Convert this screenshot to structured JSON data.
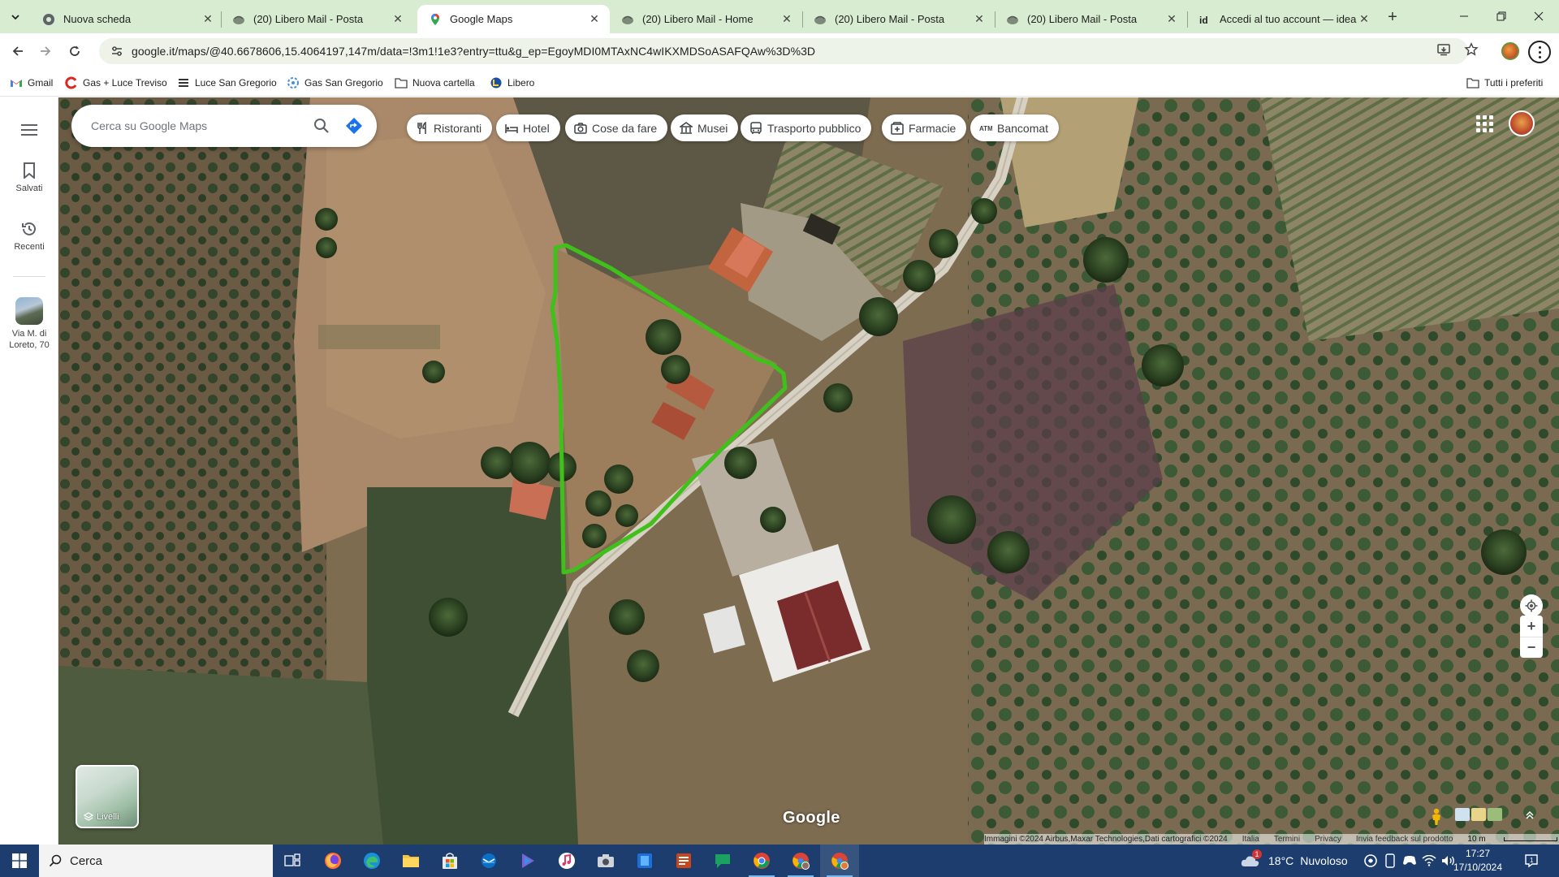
{
  "browser": {
    "tabs": [
      {
        "title": "Nuova scheda",
        "icon": "chrome-icon",
        "active": false
      },
      {
        "title": "(20) Libero Mail - Posta",
        "icon": "libero-icon",
        "active": false
      },
      {
        "title": "Google Maps",
        "icon": "maps-pin-icon",
        "active": true
      },
      {
        "title": "(20) Libero Mail - Home",
        "icon": "libero-icon",
        "active": false
      },
      {
        "title": "(20) Libero Mail - Posta",
        "icon": "libero-icon",
        "active": false
      },
      {
        "title": "(20) Libero Mail - Posta",
        "icon": "libero-icon",
        "active": false
      },
      {
        "title": "Accedi al tuo account — idealis",
        "icon": "idealista-icon",
        "active": false
      }
    ],
    "url": "google.it/maps/@40.6678606,15.4064197,147m/data=!3m1!1e3?entry=ttu&g_ep=EgoyMDI0MTAxNC4wIKXMDSoASAFQAw%3D%3D",
    "bookmarks": [
      {
        "label": "Gmail",
        "icon": "gmail-icon"
      },
      {
        "label": "Gas + Luce Treviso",
        "icon": "gas-icon"
      },
      {
        "label": "Luce San Gregorio",
        "icon": "luce-icon"
      },
      {
        "label": "Gas San Gregorio",
        "icon": "gas-blue-icon"
      },
      {
        "label": "Nuova cartella",
        "icon": "folder-icon"
      },
      {
        "label": "Libero",
        "icon": "libero-icon"
      }
    ],
    "all_bookmarks_label": "Tutti i preferiti"
  },
  "maps": {
    "sidebar": {
      "saved_label": "Salvati",
      "recent_label": "Recenti",
      "recent_place_label": "Via M. di Loreto, 70"
    },
    "search": {
      "placeholder": "Cerca su Google Maps"
    },
    "chips": [
      {
        "label": "Ristoranti",
        "icon": "fork-knife-icon"
      },
      {
        "label": "Hotel",
        "icon": "bed-icon"
      },
      {
        "label": "Cose da fare",
        "icon": "camera-icon"
      },
      {
        "label": "Musei",
        "icon": "museum-icon"
      },
      {
        "label": "Trasporto pubblico",
        "icon": "bus-icon"
      },
      {
        "label": "Farmacie",
        "icon": "pharmacy-icon"
      },
      {
        "label": "Bancomat",
        "icon": "atm-icon"
      }
    ],
    "layers_label": "Livelli",
    "logo_text": "Google",
    "attribution": "Immagini ©2024 Airbus,Maxar Technologies,Dati cartografici ©2024",
    "footer_links": [
      "Italia",
      "Termini",
      "Privacy",
      "Invia feedback sul prodotto"
    ],
    "scale_label": "10 m",
    "drawn_outline_color": "#3fc01a"
  },
  "taskbar": {
    "search_label": "Cerca",
    "weather_temp": "18°C",
    "weather_text": "Nuvoloso",
    "weather_badge": "1",
    "time": "17:27",
    "date": "17/10/2024"
  }
}
